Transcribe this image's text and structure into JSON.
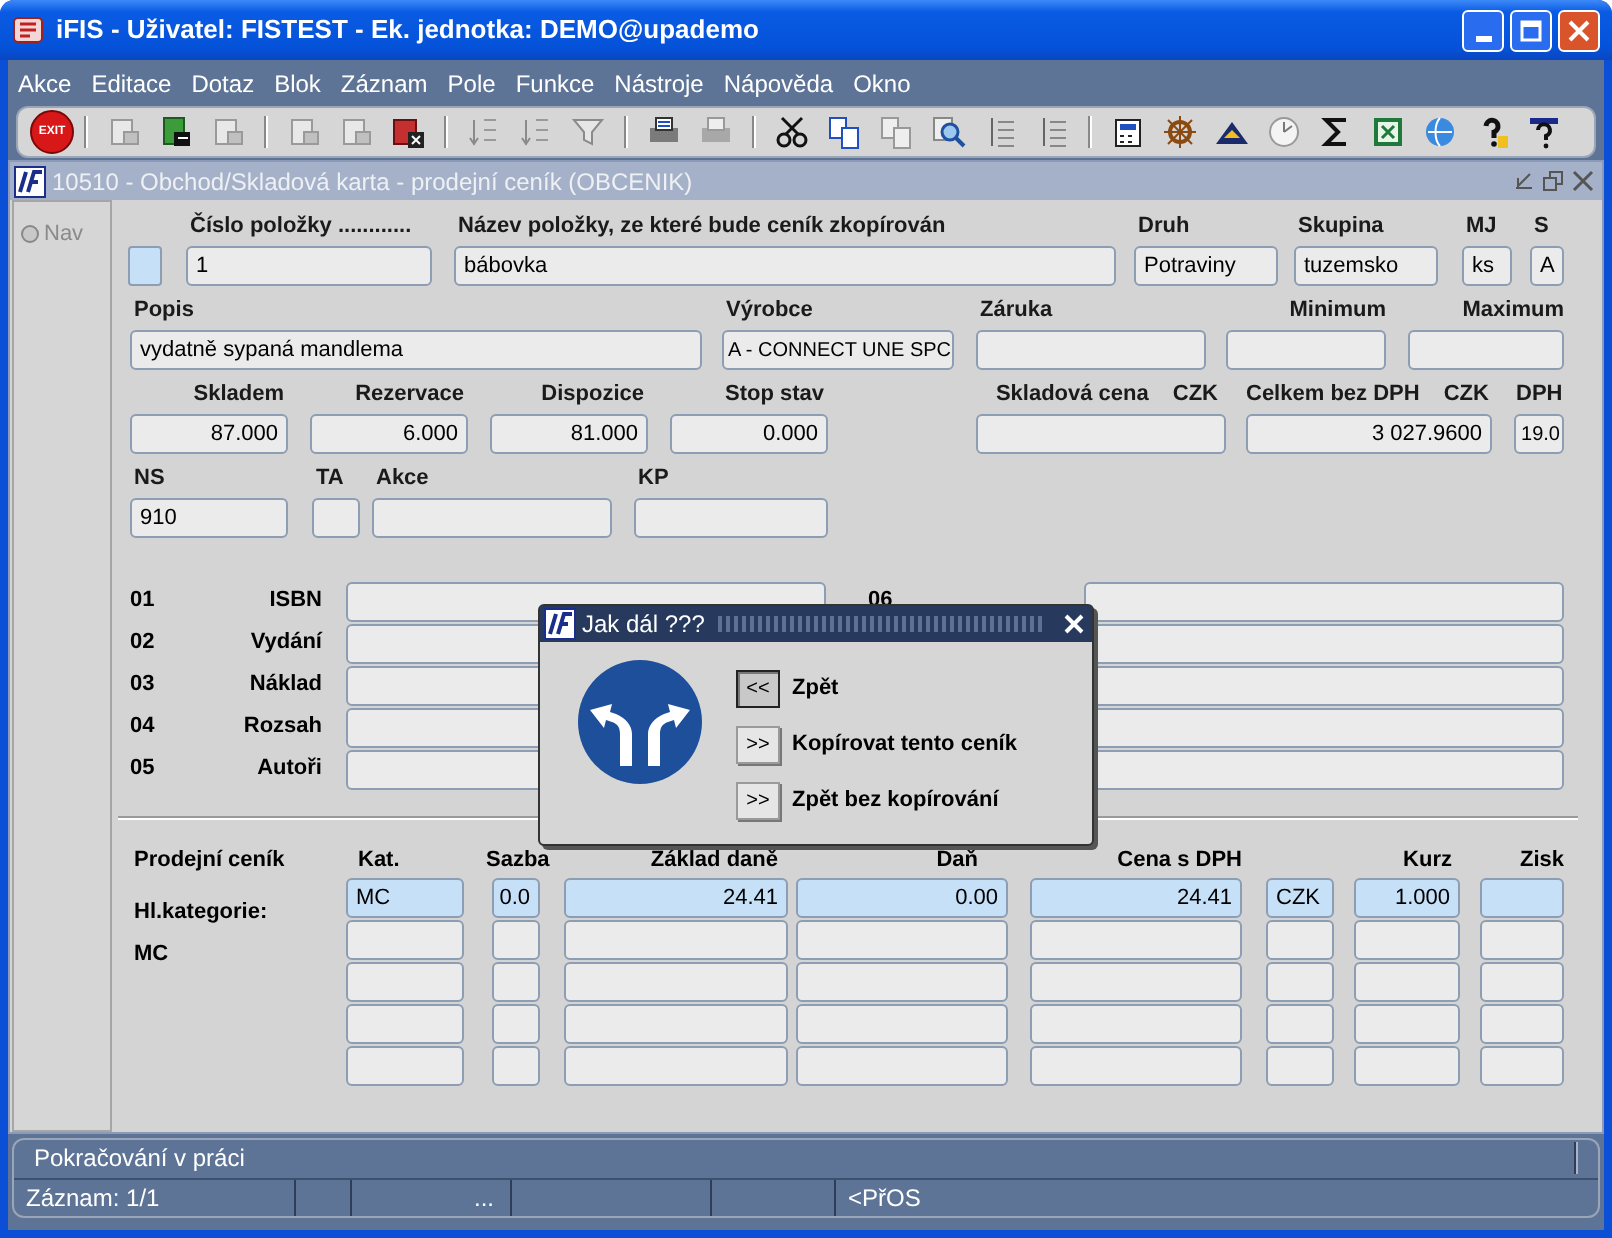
{
  "window": {
    "title": "iFIS - Uživatel: FISTEST - Ek. jednotka: DEMO@upademo"
  },
  "menu": [
    "Akce",
    "Editace",
    "Dotaz",
    "Blok",
    "Záznam",
    "Pole",
    "Funkce",
    "Nástroje",
    "Nápověda",
    "Okno"
  ],
  "toolbar": {
    "exit_label": "EXIT"
  },
  "form_window": {
    "title": "10510 - Obchod/Skladová karta - prodejní ceník (OBCENIK)",
    "nav_label": "Nav"
  },
  "row_1": [
    {
      "label": "Číslo položky ............",
      "value": "1"
    },
    {
      "label": "Název položky, ze které bude ceník zkopírován",
      "value": "bábovka"
    },
    {
      "label": "Druh",
      "value": "Potraviny"
    },
    {
      "label": "Skupina",
      "value": "tuzemsko"
    },
    {
      "label": "MJ",
      "value": "ks"
    },
    {
      "label": "S",
      "value": "A"
    }
  ],
  "row_2": [
    {
      "label": "Popis",
      "value": "vydatně sypaná mandlema"
    },
    {
      "label": "Výrobce",
      "value": "A - CONNECT UNE SPC"
    },
    {
      "label": "Záruka"
    },
    {
      "label": "Minimum"
    },
    {
      "label": "Maximum"
    }
  ],
  "row_3": [
    {
      "label": "Skladem",
      "value": "87.000"
    },
    {
      "label": "Rezervace",
      "value": "6.000"
    },
    {
      "label": "Dispozice",
      "value": "81.000"
    },
    {
      "label": "Stop stav",
      "value": "0.000"
    },
    {
      "label": "Skladová cena",
      "currency": "CZK"
    },
    {
      "label": "Celkem bez DPH",
      "currency": "CZK",
      "value": "3 027.9600"
    },
    {
      "label": "DPH",
      "value": "19.0"
    }
  ],
  "row_4": [
    {
      "label": "NS",
      "value": "910"
    },
    {
      "label": "TA"
    },
    {
      "label": "Akce"
    },
    {
      "label": "KP"
    }
  ],
  "attributes": [
    {
      "number": "01",
      "label": "ISBN",
      "right_label": "06"
    },
    {
      "number": "02",
      "label": "Vydání"
    },
    {
      "number": "03",
      "label": "Náklad"
    },
    {
      "number": "04",
      "label": "Rozsah"
    },
    {
      "number": "05",
      "label": "Autoři"
    }
  ],
  "price_list": {
    "title": "Prodejní ceník",
    "columns": [
      "Kat.",
      "Sazba",
      "Základ daně",
      "Daň",
      "Cena s DPH",
      "Kurz",
      "Zisk"
    ],
    "rows": [
      {
        "row_label": "Hl.kategorie:",
        "selected": true,
        "cells": [
          "MC",
          "0.0",
          "24.41",
          "0.00",
          "24.41",
          "CZK",
          "1.000"
        ]
      },
      {
        "row_label": "MC",
        "selected": false
      },
      {
        "selected": false
      },
      {
        "selected": false
      },
      {
        "selected": false
      }
    ]
  },
  "dialog": {
    "title": "Jak dál ???",
    "buttons": [
      {
        "icon": "<<",
        "label": "Zpět",
        "selected": true
      },
      {
        "icon": ">>",
        "label": "Kopírovat tento ceník",
        "selected": false
      },
      {
        "icon": ">>",
        "label": "Zpět bez kopírování",
        "selected": false
      }
    ]
  },
  "status": {
    "message": "Pokračování v práci",
    "record": "Záznam: 1/1",
    "ellipsis": "...",
    "mode": "<PřOS"
  }
}
